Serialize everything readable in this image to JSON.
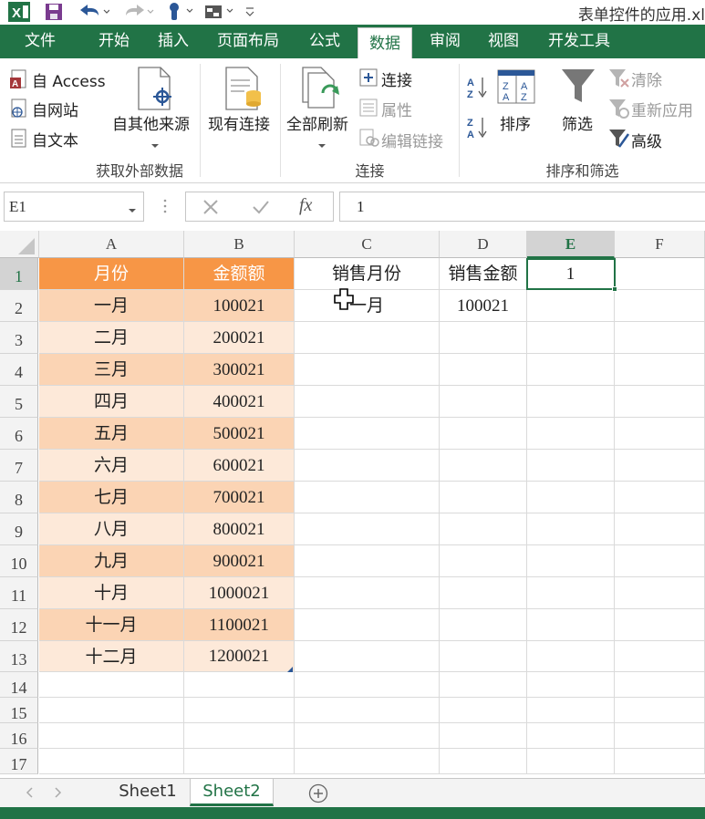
{
  "window": {
    "title": "表单控件的应用.xl",
    "quick_access": [
      "excel-logo-icon",
      "save-icon",
      "undo-icon",
      "redo-icon",
      "touch-mode-icon",
      "customize-icon"
    ]
  },
  "tabs": [
    {
      "label": "文件",
      "active": false
    },
    {
      "label": "开始",
      "active": false
    },
    {
      "label": "插入",
      "active": false
    },
    {
      "label": "页面布局",
      "active": false
    },
    {
      "label": "公式",
      "active": false
    },
    {
      "label": "数据",
      "active": true
    },
    {
      "label": "审阅",
      "active": false
    },
    {
      "label": "视图",
      "active": false
    },
    {
      "label": "开发工具",
      "active": false
    }
  ],
  "ribbon": {
    "get_external": {
      "from_access": "自 Access",
      "from_web": "自网站",
      "from_text": "自文本",
      "from_other": "自其他来源",
      "existing": "现有连接",
      "label": "获取外部数据"
    },
    "connections": {
      "refresh_all": "全部刷新",
      "connections": "连接",
      "properties": "属性",
      "edit_links": "编辑链接",
      "label": "连接"
    },
    "sort_filter": {
      "sort": "排序",
      "filter": "筛选",
      "clear": "清除",
      "reapply": "重新应用",
      "advanced": "高级",
      "label": "排序和筛选"
    }
  },
  "formula_bar": {
    "name_box": "E1",
    "fx": "fx",
    "value": "1"
  },
  "columns": [
    "A",
    "B",
    "C",
    "D",
    "E",
    "F"
  ],
  "selected_column": "E",
  "selected_row": "1",
  "rows": [
    "1",
    "2",
    "3",
    "4",
    "5",
    "6",
    "7",
    "8",
    "9",
    "10",
    "11",
    "12",
    "13",
    "14",
    "15",
    "16",
    "17"
  ],
  "table": {
    "headers": [
      "月份",
      "金额额"
    ],
    "rows": [
      [
        "一月",
        "100021"
      ],
      [
        "二月",
        "200021"
      ],
      [
        "三月",
        "300021"
      ],
      [
        "四月",
        "400021"
      ],
      [
        "五月",
        "500021"
      ],
      [
        "六月",
        "600021"
      ],
      [
        "七月",
        "700021"
      ],
      [
        "八月",
        "800021"
      ],
      [
        "九月",
        "900021"
      ],
      [
        "十月",
        "1000021"
      ],
      [
        "十一月",
        "1100021"
      ],
      [
        "十二月",
        "1200021"
      ]
    ]
  },
  "lookup": {
    "c1": "销售月份",
    "d1": "销售金额",
    "e1": "1",
    "c2": "一月",
    "d2": "100021"
  },
  "sheets": [
    {
      "label": "Sheet1",
      "active": false
    },
    {
      "label": "Sheet2",
      "active": true
    }
  ],
  "colors": {
    "accent": "#217346",
    "header_fill": "#f79646",
    "band_dark": "#fbd4b4",
    "band_light": "#fde9d9"
  }
}
